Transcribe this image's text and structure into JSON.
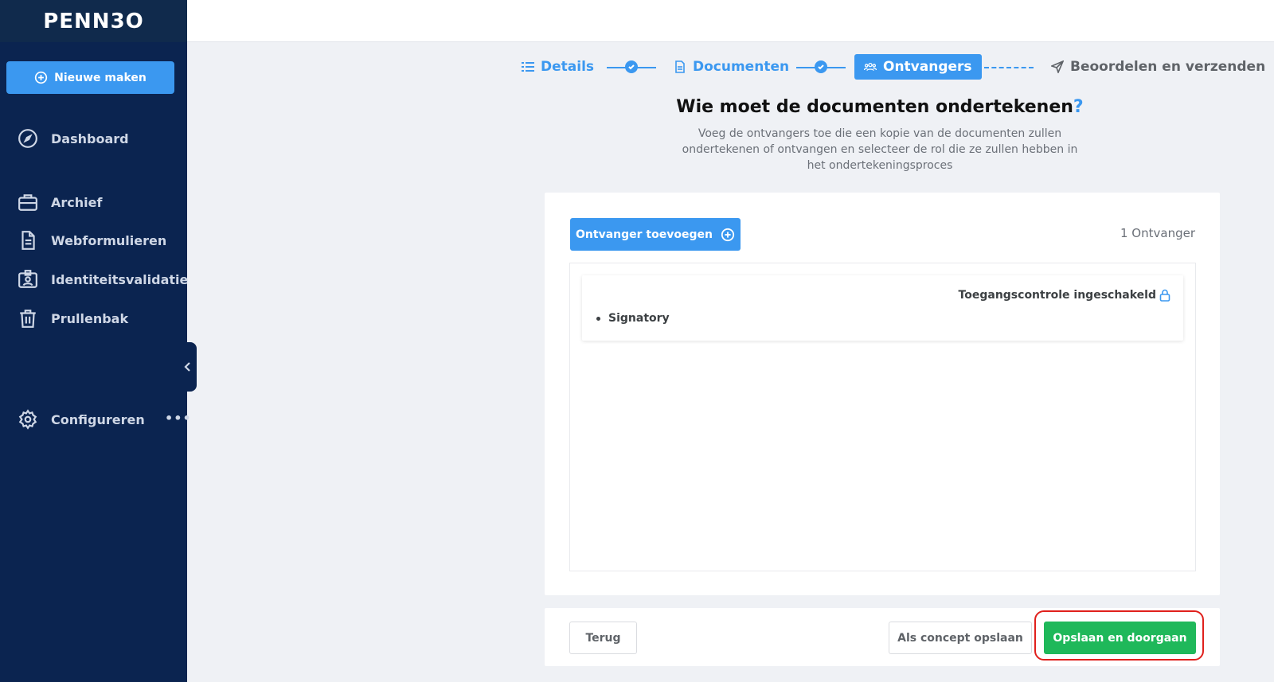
{
  "brand": {
    "logo_text": "PENN3O"
  },
  "sidebar": {
    "new_button": "Nieuwe maken",
    "items": [
      {
        "label": "Dashboard",
        "icon": "compass-icon"
      },
      {
        "label": "Archief",
        "icon": "briefcase-icon"
      },
      {
        "label": "Webformulieren",
        "icon": "document-icon"
      },
      {
        "label": "Identiteitsvalidatie",
        "icon": "id-badge-icon"
      },
      {
        "label": "Prullenbak",
        "icon": "trash-icon"
      },
      {
        "label": "Configureren",
        "icon": "gear-icon"
      }
    ],
    "more_label": "•••"
  },
  "stepper": {
    "steps": [
      {
        "label": "Details",
        "state": "done"
      },
      {
        "label": "Documenten",
        "state": "done"
      },
      {
        "label": "Ontvangers",
        "state": "active"
      },
      {
        "label": "Beoordelen en verzenden",
        "state": "pending"
      }
    ]
  },
  "main": {
    "title": "Wie moet de documenten ondertekenen",
    "title_mark": "?",
    "subtitle": "Voeg de ontvangers toe die een kopie van de documenten zullen ondertekenen of ontvangen en selecteer de rol die ze zullen hebben in het ondertekeningsproces"
  },
  "recipients": {
    "add_button": "Ontvanger toevoegen",
    "count_label": "1 Ontvanger",
    "list": [
      {
        "access_label": "Toegangscontrole ingeschakeld",
        "role": "Signatory"
      }
    ]
  },
  "footer": {
    "back": "Terug",
    "save_draft": "Als concept opslaan",
    "save_continue": "Opslaan en doorgaan"
  },
  "colors": {
    "sidebar_bg": "#0b2450",
    "accent": "#3b98f0",
    "success": "#1fb85a",
    "highlight": "#e0201c"
  }
}
